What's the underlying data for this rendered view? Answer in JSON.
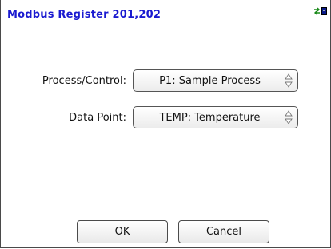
{
  "window": {
    "title": "Modbus Register 201,202"
  },
  "status": {
    "sync_icon": "sync-arrows-icon",
    "device_icon": "device-icon"
  },
  "form": {
    "process_label": "Process/Control:",
    "process_value": "P1: Sample Process",
    "datapoint_label": "Data Point:",
    "datapoint_value": "TEMP: Temperature"
  },
  "buttons": {
    "ok": "OK",
    "cancel": "Cancel"
  },
  "colors": {
    "title": "#1a1ad0",
    "arrows": "#1a8a1a"
  }
}
